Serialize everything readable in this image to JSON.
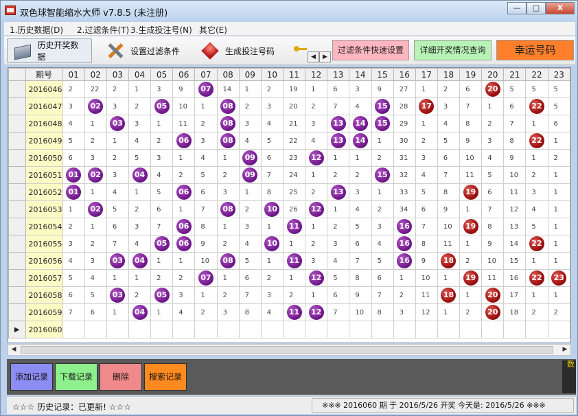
{
  "window": {
    "title": "双色球智能缩水大师 v7.8.5  (未注册)",
    "minimize": "—",
    "maximize": "□",
    "close": "X"
  },
  "menu": [
    "1.历史数据(D)",
    "2.过滤条件(T)",
    "3.生成投注号(N)",
    "其它(E)"
  ],
  "toolbar": {
    "history": "历史开奖数据",
    "filter": "设置过滤条件",
    "generate": "生成投注号码",
    "quick_filter": "过滤条件快速设置",
    "detail_query": "详细开奖情况查询",
    "lucky": "幸运号码"
  },
  "grid": {
    "period_header": "期号",
    "columns": [
      "01",
      "02",
      "03",
      "04",
      "05",
      "06",
      "07",
      "08",
      "09",
      "10",
      "11",
      "12",
      "13",
      "14",
      "15",
      "16",
      "17",
      "18",
      "19",
      "20",
      "21",
      "22",
      "23"
    ],
    "rows": [
      {
        "period": "2016046",
        "cells": [
          "2",
          "22",
          "2",
          "1",
          "3",
          "9",
          "07",
          "14",
          "1",
          "2",
          "19",
          "1",
          "6",
          "3",
          "9",
          "27",
          "1",
          "2",
          "6",
          "20",
          "5",
          "5",
          "5"
        ],
        "hits": [
          7
        ],
        "blue_hit": 20
      },
      {
        "period": "2016047",
        "cells": [
          "3",
          "02",
          "3",
          "2",
          "05",
          "10",
          "1",
          "08",
          "2",
          "3",
          "20",
          "2",
          "7",
          "4",
          "15",
          "28",
          "17",
          "3",
          "7",
          "1",
          "6",
          "22",
          "5"
        ],
        "hits": [
          2,
          5,
          8,
          15
        ],
        "blue_hit": null,
        "blue_cols": [
          17,
          22
        ]
      },
      {
        "period": "2016048",
        "cells": [
          "4",
          "1",
          "03",
          "3",
          "1",
          "11",
          "2",
          "08",
          "3",
          "4",
          "21",
          "3",
          "13",
          "14",
          "15",
          "29",
          "1",
          "4",
          "8",
          "2",
          "7",
          "1",
          "6"
        ],
        "hits": [
          3,
          8,
          13,
          14,
          15
        ],
        "blue_hit": null
      },
      {
        "period": "2016049",
        "cells": [
          "5",
          "2",
          "1",
          "4",
          "2",
          "06",
          "3",
          "08",
          "4",
          "5",
          "22",
          "4",
          "13",
          "14",
          "1",
          "30",
          "2",
          "5",
          "9",
          "3",
          "8",
          "22",
          "1"
        ],
        "hits": [
          6,
          8,
          13,
          14
        ],
        "blue_hit": 22
      },
      {
        "period": "2016050",
        "cells": [
          "6",
          "3",
          "2",
          "5",
          "3",
          "1",
          "4",
          "1",
          "09",
          "6",
          "23",
          "12",
          "1",
          "1",
          "2",
          "31",
          "3",
          "6",
          "10",
          "4",
          "9",
          "1",
          "2"
        ],
        "hits": [
          9,
          12
        ],
        "blue_hit": null
      },
      {
        "period": "2016051",
        "cells": [
          "01",
          "02",
          "3",
          "04",
          "4",
          "2",
          "5",
          "2",
          "09",
          "7",
          "24",
          "1",
          "2",
          "2",
          "15",
          "32",
          "4",
          "7",
          "11",
          "5",
          "10",
          "2",
          "1"
        ],
        "hits": [
          1,
          2,
          4,
          9,
          15
        ],
        "blue_hit": null
      },
      {
        "period": "2016052",
        "cells": [
          "01",
          "1",
          "4",
          "1",
          "5",
          "06",
          "6",
          "3",
          "1",
          "8",
          "25",
          "2",
          "13",
          "3",
          "1",
          "33",
          "5",
          "8",
          "19",
          "6",
          "11",
          "3",
          "1"
        ],
        "hits": [
          1,
          6,
          13
        ],
        "blue_hit": 19
      },
      {
        "period": "2016053",
        "cells": [
          "1",
          "02",
          "5",
          "2",
          "6",
          "1",
          "7",
          "08",
          "2",
          "10",
          "26",
          "12",
          "1",
          "4",
          "2",
          "34",
          "6",
          "9",
          "1",
          "7",
          "12",
          "4",
          "1"
        ],
        "hits": [
          2,
          8,
          10,
          12
        ],
        "blue_hit": null
      },
      {
        "period": "2016054",
        "cells": [
          "2",
          "1",
          "6",
          "3",
          "7",
          "06",
          "8",
          "1",
          "3",
          "1",
          "11",
          "1",
          "2",
          "5",
          "3",
          "16",
          "7",
          "10",
          "19",
          "8",
          "13",
          "5",
          "1"
        ],
        "hits": [
          6,
          11,
          16
        ],
        "blue_hit": 19
      },
      {
        "period": "2016055",
        "cells": [
          "3",
          "2",
          "7",
          "4",
          "05",
          "06",
          "9",
          "2",
          "4",
          "10",
          "1",
          "2",
          "3",
          "6",
          "4",
          "16",
          "8",
          "11",
          "1",
          "9",
          "14",
          "22",
          "1"
        ],
        "hits": [
          5,
          6,
          10,
          16
        ],
        "blue_hit": 22
      },
      {
        "period": "2016056",
        "cells": [
          "4",
          "3",
          "03",
          "04",
          "1",
          "1",
          "10",
          "08",
          "5",
          "1",
          "11",
          "3",
          "4",
          "7",
          "5",
          "16",
          "9",
          "18",
          "2",
          "10",
          "15",
          "1",
          "1"
        ],
        "hits": [
          3,
          4,
          8,
          11,
          16
        ],
        "blue_hit": 18
      },
      {
        "period": "2016057",
        "cells": [
          "5",
          "4",
          "1",
          "1",
          "2",
          "2",
          "07",
          "1",
          "6",
          "2",
          "1",
          "12",
          "5",
          "8",
          "6",
          "1",
          "10",
          "1",
          "19",
          "11",
          "16",
          "22",
          "23"
        ],
        "hits": [
          7,
          12
        ],
        "blue_hit": null,
        "blue_cols": [
          19,
          22,
          23
        ]
      },
      {
        "period": "2016058",
        "cells": [
          "6",
          "5",
          "03",
          "2",
          "05",
          "3",
          "1",
          "2",
          "7",
          "3",
          "2",
          "1",
          "6",
          "9",
          "7",
          "2",
          "11",
          "18",
          "1",
          "20",
          "17",
          "1",
          "1"
        ],
        "hits": [
          3,
          5
        ],
        "blue_hit": null,
        "blue_cols": [
          18,
          20
        ]
      },
      {
        "period": "2016059",
        "cells": [
          "7",
          "6",
          "1",
          "04",
          "1",
          "4",
          "2",
          "3",
          "8",
          "4",
          "11",
          "12",
          "7",
          "10",
          "8",
          "3",
          "12",
          "1",
          "2",
          "20",
          "18",
          "2",
          "2"
        ],
        "hits": [
          4,
          11,
          12
        ],
        "blue_hit": 20
      },
      {
        "period": "2016060",
        "cells": [
          "",
          "",
          "",
          "",
          "",
          "",
          "",
          "",
          "",
          "",
          "",
          "",
          "",
          "",
          "",
          "",
          "",
          "",
          "",
          "",
          "",
          "",
          ""
        ],
        "hits": [],
        "blue_hit": null
      }
    ]
  },
  "actions": {
    "add": "添加记录",
    "download": "下载记录",
    "delete": "删除",
    "search": "搜索记录"
  },
  "side_note": "数",
  "status": {
    "left": "☆☆☆ 历史记录：已更新!  ☆☆☆",
    "right": "※※※  2016060 期 于 2016/5/26 开奖     今天是:  2016/5/26 ※※※"
  },
  "colors": {
    "red_ball": "#7a1f95",
    "blue_ball": "#a51514",
    "period_bg": "#fbfbc6"
  }
}
